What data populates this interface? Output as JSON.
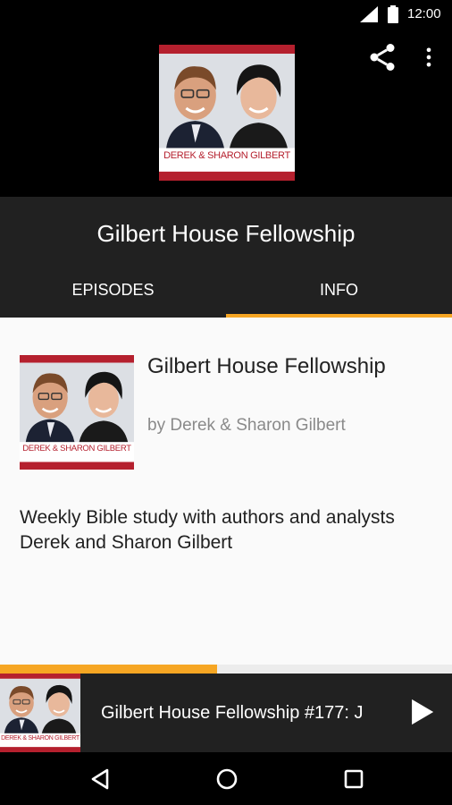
{
  "status_bar": {
    "time": "12:00",
    "signal_icon": "cell-signal-icon",
    "battery_icon": "battery-icon"
  },
  "header": {
    "cover_caption": "DEREK & SHARON GILBERT",
    "actions": [
      "share-icon",
      "more-vert-icon"
    ]
  },
  "show": {
    "title": "Gilbert House Fellowship"
  },
  "tabs": [
    {
      "label": "EPISODES",
      "selected": false
    },
    {
      "label": "INFO",
      "selected": true
    }
  ],
  "info": {
    "title": "Gilbert House Fellowship",
    "author": "by Derek & Sharon Gilbert",
    "description": "Weekly Bible study with authors and analysts Derek and Sharon Gilbert"
  },
  "player": {
    "now_playing": "Gilbert House Fellowship #177: J",
    "progress": 0.48,
    "play_icon": "play-icon"
  },
  "nav": {
    "icons": [
      "back-icon",
      "home-icon",
      "recents-icon"
    ]
  },
  "colors": {
    "accent": "#f6a623",
    "toolbar": "#212121",
    "cover_red": "#b5202e"
  }
}
